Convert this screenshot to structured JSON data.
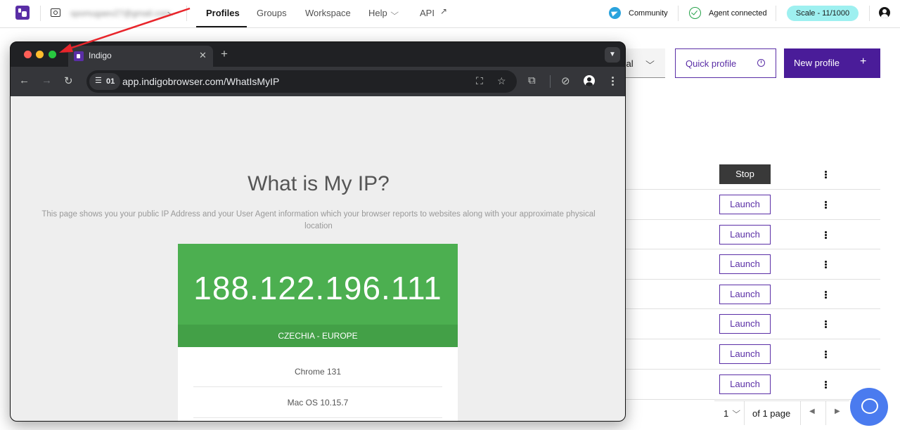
{
  "topnav": {
    "workspace_email": "spomugaev27@gmail.com",
    "tabs": [
      "Profiles",
      "Groups",
      "Workspace",
      "Help",
      "API"
    ],
    "community": "Community",
    "agent_status": "Agent connected",
    "plan_badge": "Scale - 11/1000"
  },
  "toolbar": {
    "filter_partial": "cal",
    "quick_profile": "Quick profile",
    "new_profile": "New profile"
  },
  "profiles_table": {
    "stop_label": "Stop",
    "launch_label": "Launch",
    "launch_count": 7
  },
  "pagination": {
    "page": "1",
    "of_pages": "of 1 page"
  },
  "browser": {
    "tab_title": "Indigo",
    "site_badge": "01",
    "url": "app.indigobrowser.com/WhatIsMyIP"
  },
  "ip_page": {
    "title": "What is My IP?",
    "description": "This page shows you your public IP Address and your User Agent information which your browser reports to websites along with your approximate physical location",
    "ip": "188.122.196.111",
    "location": "CZECHIA - EUROPE",
    "browser": "Chrome 131",
    "os": "Mac OS 10.15.7"
  },
  "colors": {
    "brand": "#4a1c99",
    "ip_green": "#4caf50",
    "arrow": "#e8252b"
  },
  "icons": [
    "logo-icon",
    "workspace-icon",
    "telegram-icon",
    "check-circle-icon",
    "user-icon",
    "timer-icon",
    "plus-icon",
    "kebab-icon",
    "chat-icon",
    "back-icon",
    "forward-icon",
    "reload-icon",
    "translate-icon",
    "star-icon",
    "extensions-icon",
    "profile-icon"
  ]
}
